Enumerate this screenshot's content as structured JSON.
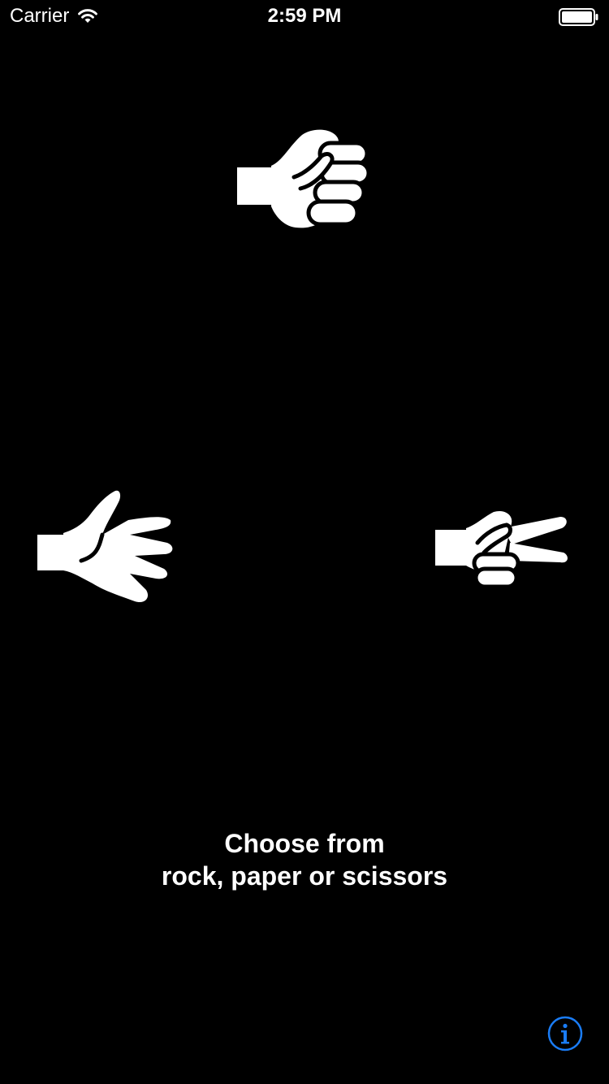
{
  "status_bar": {
    "carrier": "Carrier",
    "time": "2:59 PM",
    "icons": [
      "wifi-icon",
      "battery-icon"
    ]
  },
  "choices": [
    {
      "id": "rock",
      "icon": "fist-icon"
    },
    {
      "id": "paper",
      "icon": "open-hand-icon"
    },
    {
      "id": "scissors",
      "icon": "peace-hand-icon"
    }
  ],
  "instruction": {
    "line1": "Choose from",
    "line2": "rock, paper or scissors"
  },
  "info_button": {
    "icon": "info-icon"
  },
  "colors": {
    "background": "#000000",
    "foreground": "#ffffff",
    "accent": "#1a7cf5"
  }
}
